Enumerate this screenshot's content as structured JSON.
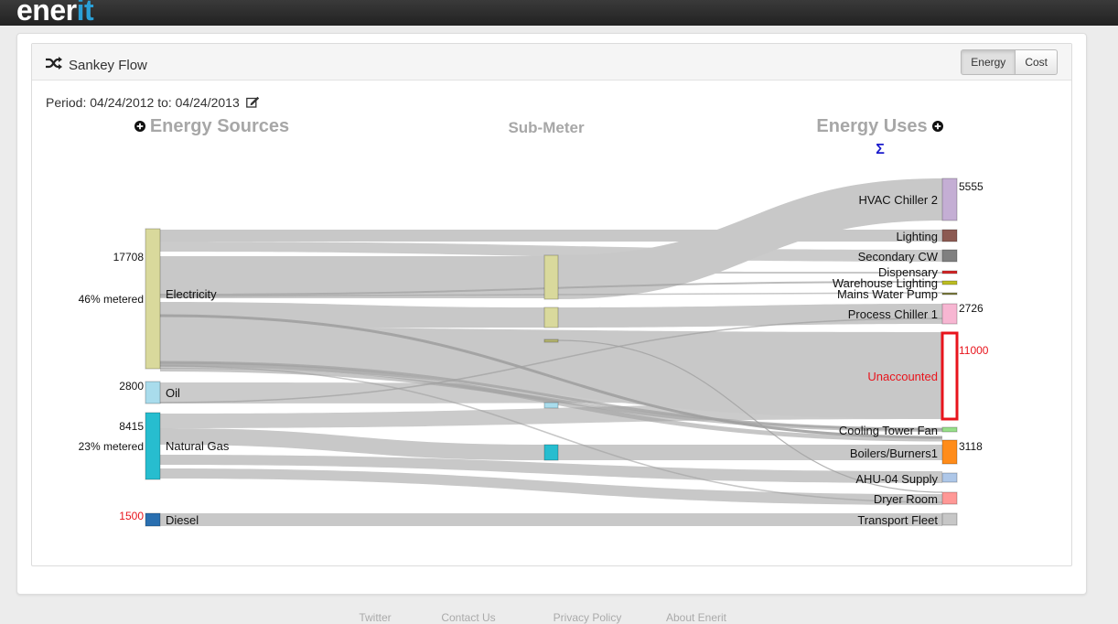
{
  "app": {
    "logo_part1": "ener",
    "logo_part2": "it"
  },
  "panel": {
    "title": "Sankey Flow",
    "period": "Period: 04/24/2012 to: 04/24/2013"
  },
  "toggle": {
    "energy": "Energy",
    "cost": "Cost",
    "active": "Energy"
  },
  "headers": {
    "sources": "Energy Sources",
    "submeter": "Sub-Meter",
    "uses": "Energy Uses",
    "sigma": "Σ"
  },
  "colors": {
    "link": "#c8c8c8",
    "alert": "#e8141c",
    "sigma": "#1a1acc"
  },
  "sources": [
    {
      "name": "Electricity",
      "value": "17708",
      "meter": "46% metered",
      "color": "#d9d99c"
    },
    {
      "name": "Oil",
      "value": "2800",
      "color": "#a9dcec"
    },
    {
      "name": "Natural Gas",
      "value": "8415",
      "meter": "23% metered",
      "color": "#27bdcf"
    },
    {
      "name": "Diesel",
      "value": "1500",
      "color": "#2a6fb0",
      "alert": true
    }
  ],
  "uses": [
    {
      "name": "HVAC Chiller 2",
      "value": "5555",
      "color": "#c4aed4"
    },
    {
      "name": "Lighting",
      "color": "#8c5a52"
    },
    {
      "name": "Secondary CW",
      "color": "#808080"
    },
    {
      "name": "Dispensary",
      "color": "#d62728"
    },
    {
      "name": "Warehouse Lighting",
      "color": "#bcbd22"
    },
    {
      "name": "Mains Water Pump",
      "color": "#7f7f3f"
    },
    {
      "name": "Process Chiller 1",
      "value": "2726",
      "color": "#f7b6d2"
    },
    {
      "name": "Unaccounted",
      "value": "11000",
      "color": "#ffffff",
      "alert": true
    },
    {
      "name": "Cooling Tower Fan",
      "color": "#98df8a"
    },
    {
      "name": "Boilers/Burners1",
      "value": "3118",
      "color": "#ff8c1a"
    },
    {
      "name": "AHU-04 Supply",
      "color": "#aec7e8"
    },
    {
      "name": "Dryer Room",
      "color": "#ff9896"
    },
    {
      "name": "Transport Fleet",
      "color": "#c7c7c7"
    }
  ],
  "footer": [
    "Twitter",
    "Contact Us",
    "Privacy Policy",
    "About Enerit"
  ]
}
